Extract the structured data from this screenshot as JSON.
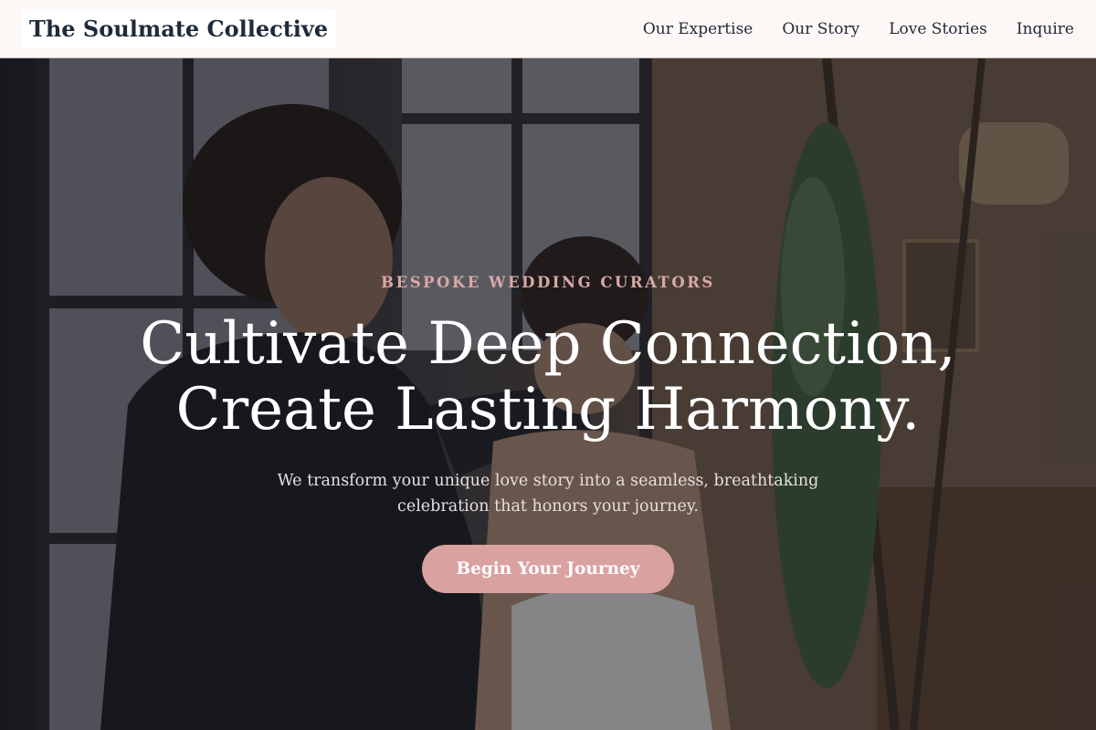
{
  "brand": {
    "name": "The Soulmate Collective"
  },
  "nav": {
    "items": [
      {
        "label": "Our Expertise"
      },
      {
        "label": "Our Story"
      },
      {
        "label": "Love Stories"
      },
      {
        "label": "Inquire"
      }
    ]
  },
  "hero": {
    "eyebrow": "BESPOKE WEDDING CURATORS",
    "headline_line1": "Cultivate Deep Connection,",
    "headline_line2": "Create Lasting Harmony.",
    "subhead": "We transform your unique love story into a seamless, breathtaking celebration that honors your journey.",
    "cta_label": "Begin Your Journey",
    "background_image": "couple-getting-ready-photo"
  },
  "colors": {
    "header_bg": "#fdf7f6",
    "brand_text": "#1f2a3a",
    "accent": "#d9a19f",
    "eyebrow": "#d9a8a6",
    "headline": "#ffffff"
  }
}
